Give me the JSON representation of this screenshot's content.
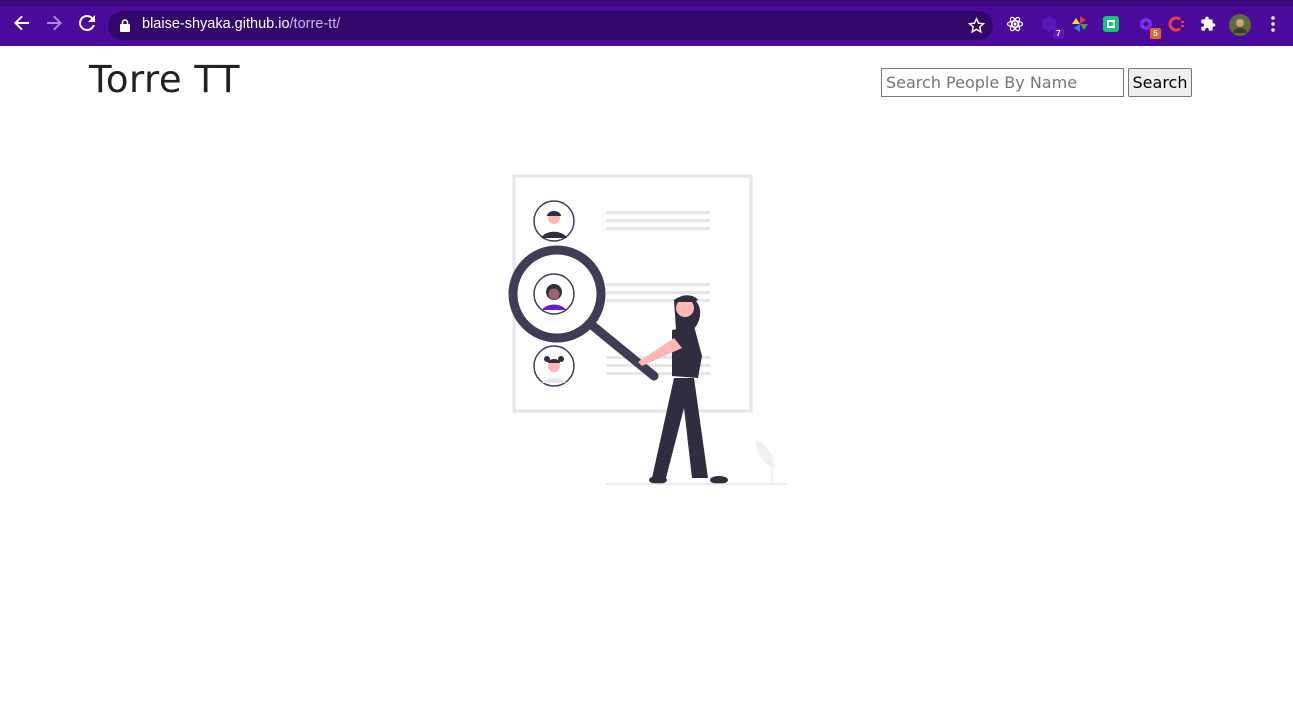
{
  "browser": {
    "url_host": "blaise-shyaka.github.io",
    "url_path": "/torre-tt/",
    "extensions": [
      {
        "name": "react-devtools-icon",
        "badge": ""
      },
      {
        "name": "extension-7-icon",
        "badge": "7"
      },
      {
        "name": "colorful-extension-icon",
        "badge": ""
      },
      {
        "name": "green-extension-icon",
        "badge": ""
      },
      {
        "name": "extension-5-icon",
        "badge": "5"
      },
      {
        "name": "c-extension-icon",
        "badge": ""
      },
      {
        "name": "puzzle-icon",
        "badge": ""
      }
    ]
  },
  "header": {
    "title": "Torre TT"
  },
  "search": {
    "placeholder": "Search People By Name",
    "button_label": "Search"
  },
  "colors": {
    "chrome": "#4a0b9c",
    "accent": "#6c1bd3",
    "figure": "#2f2e41",
    "skin": "#ffb6b6"
  }
}
